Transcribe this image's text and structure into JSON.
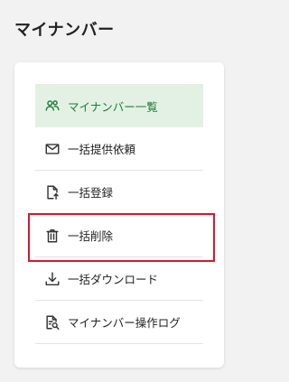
{
  "header": {
    "title": "マイナンバー"
  },
  "menu": {
    "items": [
      {
        "label": "マイナンバー一覧",
        "icon": "people-icon",
        "active": true
      },
      {
        "label": "一括提供依頼",
        "icon": "mail-icon",
        "active": false
      },
      {
        "label": "一括登録",
        "icon": "file-upload-icon",
        "active": false
      },
      {
        "label": "一括削除",
        "icon": "trash-icon",
        "active": false
      },
      {
        "label": "一括ダウンロード",
        "icon": "download-icon",
        "active": false
      },
      {
        "label": "マイナンバー操作ログ",
        "icon": "file-search-icon",
        "active": false
      }
    ]
  },
  "colors": {
    "accent": "#1e7b34",
    "active_bg": "#e3f1e5",
    "highlight_border": "#d6182c"
  }
}
